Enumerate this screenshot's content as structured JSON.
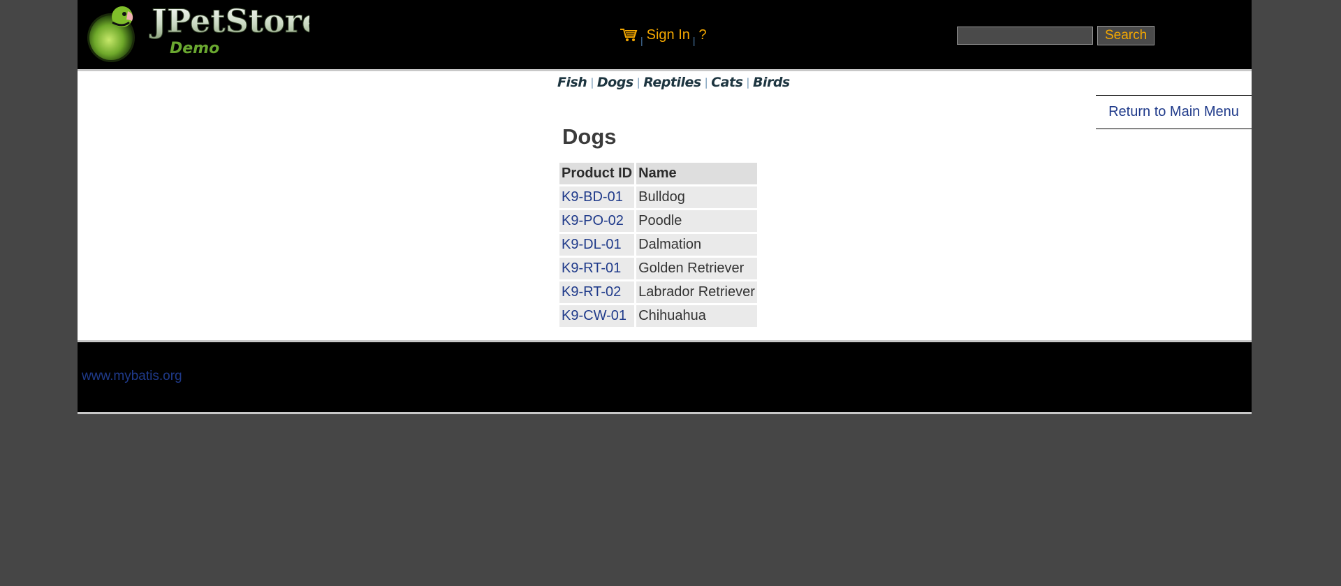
{
  "header": {
    "logo": {
      "title": "JPetStore",
      "subtitle": "Demo"
    },
    "menu": {
      "cart_icon": "shopping-cart-icon",
      "sign_in_label": "Sign In",
      "help_label": "?",
      "separator": "|"
    },
    "search": {
      "value": "",
      "button_label": "Search"
    }
  },
  "quick_links": {
    "separator": "|",
    "items": [
      "Fish",
      "Dogs",
      "Reptiles",
      "Cats",
      "Birds"
    ]
  },
  "back_link": {
    "label": "Return to Main Menu"
  },
  "catalog": {
    "title": "Dogs",
    "columns": [
      "Product ID",
      "Name"
    ],
    "rows": [
      {
        "id": "K9-BD-01",
        "name": "Bulldog"
      },
      {
        "id": "K9-PO-02",
        "name": "Poodle"
      },
      {
        "id": "K9-DL-01",
        "name": "Dalmation"
      },
      {
        "id": "K9-RT-01",
        "name": "Golden Retriever"
      },
      {
        "id": "K9-RT-02",
        "name": "Labrador Retriever"
      },
      {
        "id": "K9-CW-01",
        "name": "Chihuahua"
      }
    ]
  },
  "footer": {
    "link_label": "www.mybatis.org"
  },
  "colors": {
    "accent": "#f5a800",
    "link": "#1f3a8a",
    "page_background": "#464646"
  }
}
